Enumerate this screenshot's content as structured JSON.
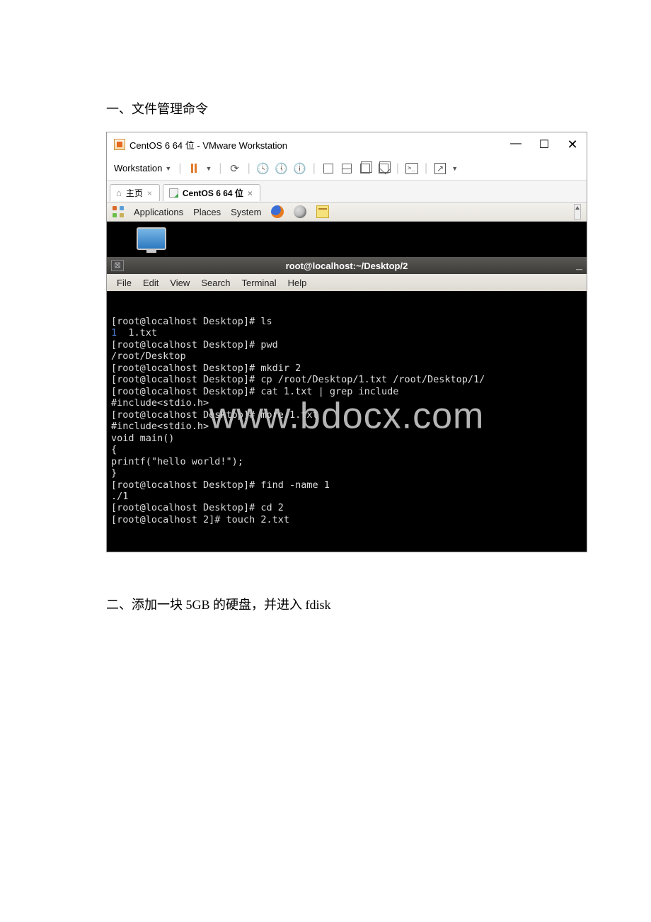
{
  "doc": {
    "heading1": "一、文件管理命令",
    "heading2": "二、添加一块 5GB 的硬盘，并进入 fdisk"
  },
  "window": {
    "app_title": "CentOS 6 64 位 - VMware Workstation",
    "minimize": "—",
    "maximize": "☐",
    "close": "✕"
  },
  "workstation_toolbar": {
    "menu_label": "Workstation"
  },
  "tabs": {
    "home_label": "主页",
    "home_close": "×",
    "vm_label": "CentOS 6 64 位",
    "vm_close": "×"
  },
  "gnome": {
    "applications": "Applications",
    "places": "Places",
    "system": "System"
  },
  "terminal": {
    "title": "root@localhost:~/Desktop/2",
    "title_left_glyph": "☒",
    "title_min": "_",
    "menu": {
      "file": "File",
      "edit": "Edit",
      "view": "View",
      "search": "Search",
      "terminal": "Terminal",
      "help": "Help"
    },
    "lines": [
      "[root@localhost Desktop]# ls",
      {
        "pre": "",
        "blue": "1",
        "post": "  1.txt"
      },
      "[root@localhost Desktop]# pwd",
      "/root/Desktop",
      "[root@localhost Desktop]# mkdir 2",
      "[root@localhost Desktop]# cp /root/Desktop/1.txt /root/Desktop/1/",
      "[root@localhost Desktop]# cat 1.txt | grep include",
      "#include<stdio.h>",
      "[root@localhost Desktop]# more 1.txt",
      "#include<stdio.h>",
      "void main()",
      "{",
      "printf(\"hello world!\");",
      "}",
      "[root@localhost Desktop]# find -name 1",
      "./1",
      "[root@localhost Desktop]# cd 2",
      "[root@localhost 2]# touch 2.txt"
    ]
  },
  "watermark": "www.bdocx.com"
}
